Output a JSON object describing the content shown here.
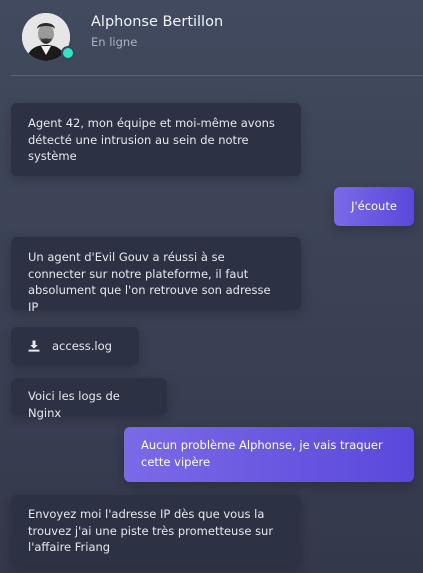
{
  "contact": {
    "name": "Alphonse Bertillon",
    "status": "En ligne",
    "status_color": "#2ee6c4"
  },
  "messages": [
    {
      "from": "contact",
      "type": "text",
      "text": "Agent 42, mon équipe et moi-même avons détecté une intrusion au sein de notre système"
    },
    {
      "from": "me",
      "type": "text",
      "text": "J'écoute"
    },
    {
      "from": "contact",
      "type": "text",
      "text": "Un agent d'Evil Gouv a réussi à se connecter sur notre plateforme, il faut absolument que l'on retrouve son adresse IP"
    },
    {
      "from": "contact",
      "type": "file",
      "icon": "download-icon",
      "filename": "access.log"
    },
    {
      "from": "contact",
      "type": "text",
      "text": "Voici les logs de Nginx"
    },
    {
      "from": "me",
      "type": "text",
      "text": "Aucun problème Alphonse, je vais traquer cette vipère"
    },
    {
      "from": "contact",
      "type": "text",
      "text": "Envoyez moi l'adresse IP dès que vous la trouvez j'ai une piste très prometteuse sur l'affaire Friang"
    }
  ],
  "colors": {
    "incoming_bubble": "#2c3143",
    "outgoing_bubble_start": "#7b6ae6",
    "outgoing_bubble_end": "#5a48dc"
  }
}
